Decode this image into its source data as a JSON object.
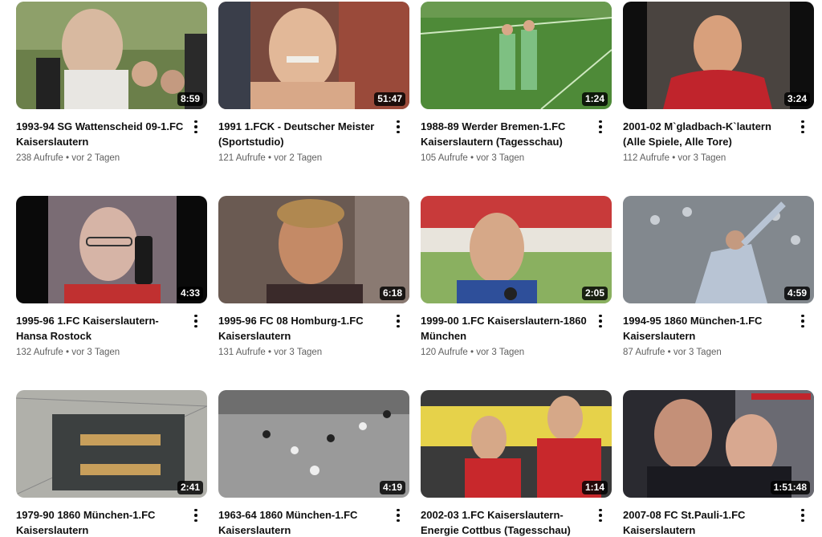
{
  "videos": [
    {
      "title": "1993-94 SG Wattenscheid 09-1.FC Kaiserslautern",
      "duration": "8:59",
      "views": "238 Aufrufe",
      "age": "vor 2 Tagen",
      "palette": [
        "#5b7a3c",
        "#d9d4c9",
        "#2a2a2a"
      ]
    },
    {
      "title": "1991 1.FCK - Deutscher Meister (Sportstudio)",
      "duration": "51:47",
      "views": "121 Aufrufe",
      "age": "vor 2 Tagen",
      "palette": [
        "#8a4a3a",
        "#e0b89a",
        "#3a3a3a"
      ]
    },
    {
      "title": "1988-89 Werder Bremen-1.FC Kaiserslautern (Tagesschau)",
      "duration": "1:24",
      "views": "105 Aufrufe",
      "age": "vor 3 Tagen",
      "palette": [
        "#4f8a3a",
        "#7fb06a",
        "#2e6b2a"
      ]
    },
    {
      "title": "2001-02 M`gladbach-K`lautern (Alle Spiele, Alle Tore)",
      "duration": "3:24",
      "views": "112 Aufrufe",
      "age": "vor 3 Tagen",
      "palette": [
        "#111111",
        "#c0242c",
        "#d9a07c"
      ]
    },
    {
      "title": "1995-96 1.FC Kaiserslautern-Hansa Rostock",
      "duration": "4:33",
      "views": "132 Aufrufe",
      "age": "vor 3 Tagen",
      "palette": [
        "#0b0b0b",
        "#8c7a84",
        "#d2b2a4"
      ]
    },
    {
      "title": "1995-96 FC 08 Homburg-1.FC Kaiserslautern",
      "duration": "6:18",
      "views": "131 Aufrufe",
      "age": "vor 3 Tagen",
      "palette": [
        "#6a5a50",
        "#c48a66",
        "#3a2a2a"
      ]
    },
    {
      "title": "1999-00 1.FC Kaiserslautern-1860 München",
      "duration": "2:05",
      "views": "120 Aufrufe",
      "age": "vor 3 Tagen",
      "palette": [
        "#b23030",
        "#d6a888",
        "#2e4f9a"
      ]
    },
    {
      "title": "1994-95 1860 München-1.FC Kaiserslautern",
      "duration": "4:59",
      "views": "87 Aufrufe",
      "age": "vor 3 Tagen",
      "palette": [
        "#8a8f95",
        "#c9ced4",
        "#4a5058"
      ]
    },
    {
      "title": "1979-90 1860 München-1.FC Kaiserslautern",
      "duration": "2:41",
      "views": "",
      "age": "",
      "palette": [
        "#a6a6a2",
        "#3c4040",
        "#e0b060"
      ]
    },
    {
      "title": "1963-64 1860 München-1.FC Kaiserslautern",
      "duration": "4:19",
      "views": "",
      "age": "",
      "palette": [
        "#9a9a9a",
        "#c4c4c4",
        "#2a2a2a"
      ]
    },
    {
      "title": "2002-03 1.FC Kaiserslautern-Energie Cottbus (Tagesschau)",
      "duration": "1:14",
      "views": "",
      "age": "",
      "palette": [
        "#c8282c",
        "#e6d24a",
        "#3a3a3a"
      ]
    },
    {
      "title": "2007-08 FC St.Pauli-1.FC Kaiserslautern",
      "duration": "1:51:48",
      "views": "",
      "age": "",
      "palette": [
        "#2a2a30",
        "#c49078",
        "#6a6a72"
      ]
    }
  ],
  "meta_separator": "•",
  "colors": {
    "title": "#0f0f0f",
    "meta": "#606060",
    "duration_bg": "#000000"
  }
}
